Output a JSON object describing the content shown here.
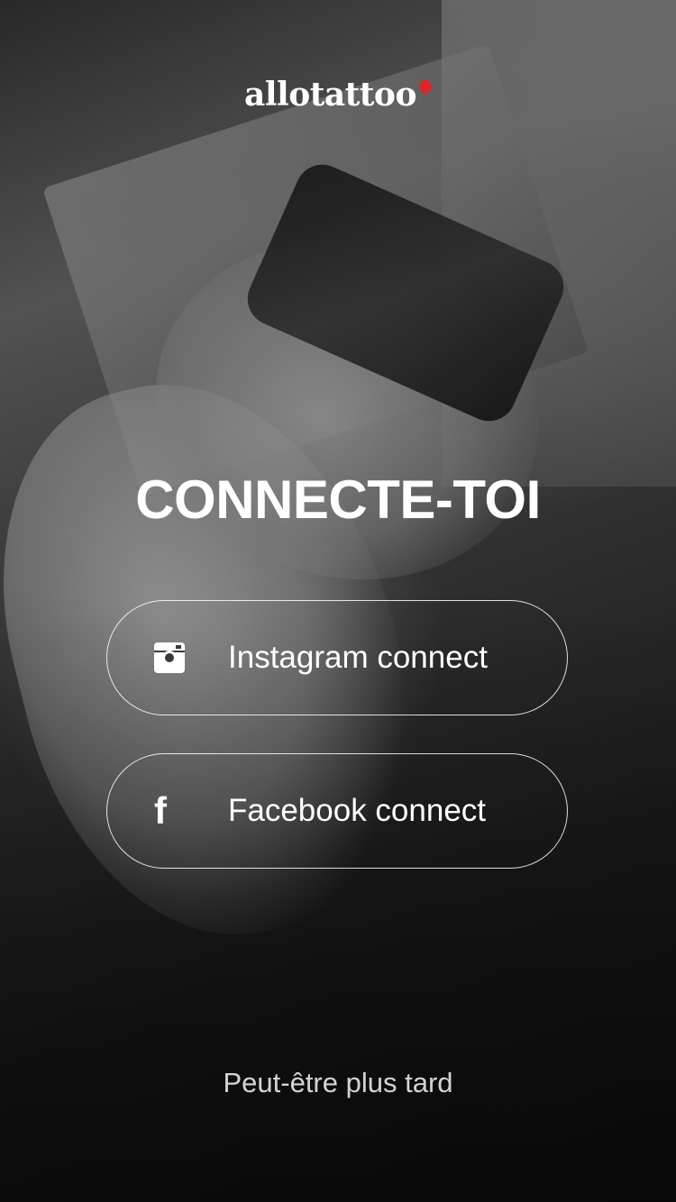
{
  "app": {
    "logo_text": "allotattoo"
  },
  "heading": "CONNECTE-TOI",
  "buttons": {
    "instagram": {
      "label": "Instagram connect",
      "icon": "instagram-icon"
    },
    "facebook": {
      "label": "Facebook connect",
      "icon": "facebook-icon"
    }
  },
  "skip_label": "Peut-être plus tard",
  "colors": {
    "pin": "#d8262b",
    "text": "#ffffff"
  }
}
